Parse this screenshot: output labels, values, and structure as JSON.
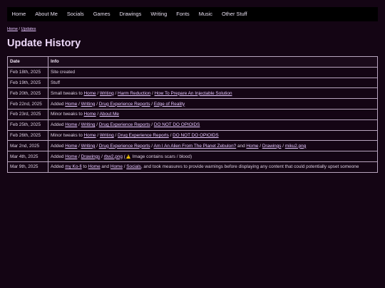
{
  "nav": [
    "Home",
    "About Me",
    "Socials",
    "Games",
    "Drawings",
    "Writing",
    "Fonts",
    "Music",
    "Other Stuff"
  ],
  "breadcrumb": {
    "home": "Home",
    "sep": " / ",
    "current": "Updates"
  },
  "page_title": "Update History",
  "table": {
    "headers": [
      "Date",
      "Info"
    ],
    "rows": [
      {
        "date": "Feb 18th, 2025",
        "info": [
          {
            "t": "Site created"
          }
        ]
      },
      {
        "date": "Feb 19th, 2025",
        "info": [
          {
            "t": "Stuff"
          }
        ]
      },
      {
        "date": "Feb 20th, 2025",
        "info": [
          {
            "t": "Small tweaks to "
          },
          {
            "l": "Home"
          },
          {
            "t": " / "
          },
          {
            "l": "Writing"
          },
          {
            "t": " / "
          },
          {
            "l": "Harm Reduction"
          },
          {
            "t": " / "
          },
          {
            "l": "How To Prepare An Injectable Solution"
          }
        ]
      },
      {
        "date": "Feb 22nd, 2025",
        "info": [
          {
            "t": "Added "
          },
          {
            "l": "Home"
          },
          {
            "t": " / "
          },
          {
            "l": "Writing"
          },
          {
            "t": " / "
          },
          {
            "l": "Drug Experience Reports"
          },
          {
            "t": " / "
          },
          {
            "l": "Edge of Reality"
          }
        ]
      },
      {
        "date": "Feb 23rd, 2025",
        "info": [
          {
            "t": "Minor tweaks to "
          },
          {
            "l": "Home"
          },
          {
            "t": " / "
          },
          {
            "l": "About Me"
          }
        ]
      },
      {
        "date": "Feb 25th, 2025",
        "info": [
          {
            "t": "Added "
          },
          {
            "l": "Home"
          },
          {
            "t": " / "
          },
          {
            "l": "Writing"
          },
          {
            "t": " / "
          },
          {
            "l": "Drug Experience Reports"
          },
          {
            "t": " / "
          },
          {
            "l": "DO NOT DO OPIOIDS"
          }
        ]
      },
      {
        "date": "Feb 26th, 2025",
        "info": [
          {
            "t": "Minor tweaks to "
          },
          {
            "l": "Home"
          },
          {
            "t": " / "
          },
          {
            "l": "Writing"
          },
          {
            "t": " / "
          },
          {
            "l": "Drug Experience Reports"
          },
          {
            "t": " / "
          },
          {
            "l": "DO NOT DO OPIOIDS"
          }
        ]
      },
      {
        "date": "Mar 2nd, 2025",
        "info": [
          {
            "t": "Added "
          },
          {
            "l": "Home"
          },
          {
            "t": " / "
          },
          {
            "l": "Writing"
          },
          {
            "t": " / "
          },
          {
            "l": "Drug Experience Reports"
          },
          {
            "t": " / "
          },
          {
            "l": "Am I An Alien From The Planet Zebulon?"
          },
          {
            "t": " and "
          },
          {
            "l": "Home"
          },
          {
            "t": " / "
          },
          {
            "l": "Drawings"
          },
          {
            "t": " / "
          },
          {
            "l": "miku2.png"
          }
        ]
      },
      {
        "date": "Mar 4th, 2025",
        "info": [
          {
            "t": "Added "
          },
          {
            "l": "Home"
          },
          {
            "t": " / "
          },
          {
            "l": "Drawings"
          },
          {
            "t": " / "
          },
          {
            "l": "rbw2.png"
          },
          {
            "t": " ("
          },
          {
            "icon": "warning-icon"
          },
          {
            "t": " Image contains scars / blood)"
          }
        ]
      },
      {
        "date": "Mar 9th, 2025",
        "info": [
          {
            "t": "Added "
          },
          {
            "l": "my Ko-fi"
          },
          {
            "t": " to "
          },
          {
            "l": "Home"
          },
          {
            "t": " and "
          },
          {
            "l": "Home"
          },
          {
            "t": " / "
          },
          {
            "l": "Socials"
          },
          {
            "t": ", and took measures to provide warnings before displaying any content that could potentially upset someone"
          }
        ]
      }
    ]
  },
  "colors": {
    "background": "#140514",
    "navbar": "#000000",
    "link": "#e6c7ff",
    "border": "#b9a6bf",
    "warning": "#f3c300"
  }
}
